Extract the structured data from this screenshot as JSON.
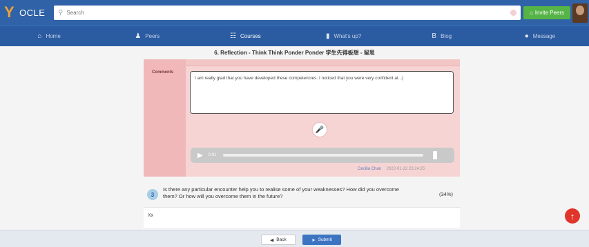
{
  "header": {
    "logo_text": "OCLE",
    "search_placeholder": "Search",
    "invite_label": "Invite Peers"
  },
  "nav": [
    {
      "label": "Home",
      "icon": "home-icon"
    },
    {
      "label": "Peers",
      "icon": "peers-icon"
    },
    {
      "label": "Courses",
      "icon": "courses-icon"
    },
    {
      "label": "What's up?",
      "icon": "chart-icon"
    },
    {
      "label": "Blog",
      "icon": "blog-icon"
    },
    {
      "label": "Message",
      "icon": "message-icon"
    }
  ],
  "section": {
    "title": "6. Reflection - Think Think Ponder Ponder 学生先得板想 - 留思"
  },
  "reflection": {
    "comments_label": "Comments",
    "comment_text": "I am really glad that you have developed these competencies. I noticed that you were very confident at...|",
    "audio_time": "0:01",
    "author": "Cecilia Chan",
    "timestamp": "2022-01-22 23:24:25"
  },
  "question": {
    "number": "3",
    "text": "Is there any particular encounter help you to realise some of your weaknesses? How did you overcome them? Or how will you overcome them in the future?",
    "percent": "(34%)",
    "answer": "Xx"
  },
  "footer": {
    "back_label": "Back",
    "submit_label": "Submit"
  }
}
